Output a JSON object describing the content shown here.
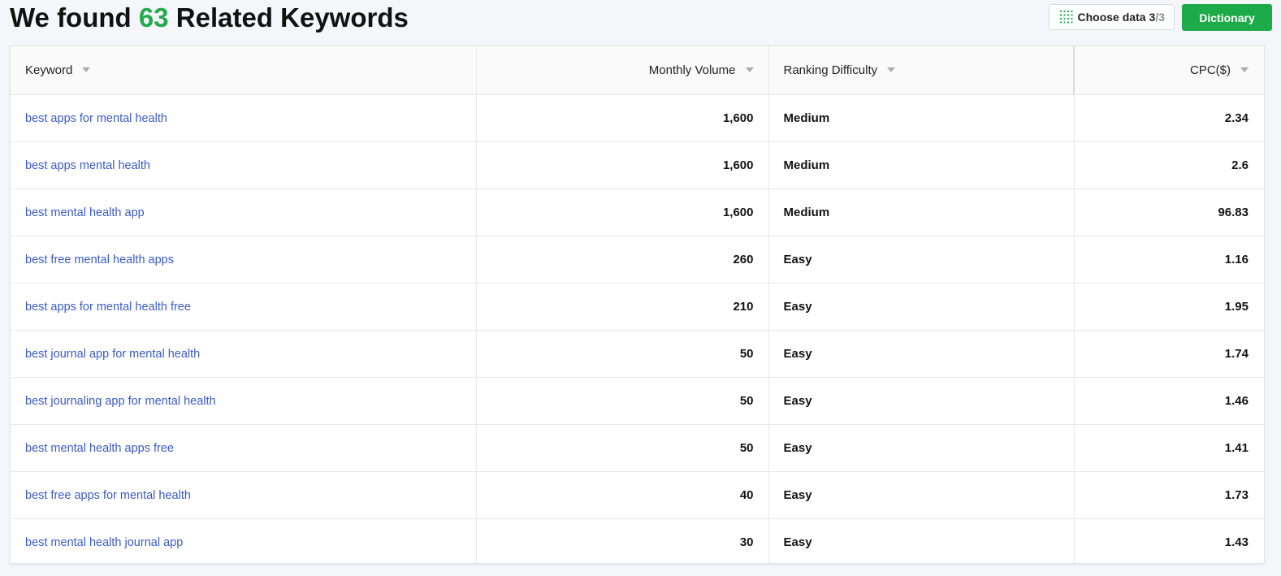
{
  "heading": {
    "prefix": "We found",
    "count": "63",
    "suffix": "Related Keywords"
  },
  "toolbar": {
    "choose_label": "Choose data",
    "choose_selected": "3",
    "choose_separator": "/",
    "choose_total": "3",
    "dictionary_label": "Dictionary"
  },
  "colors": {
    "accent_green": "#1cab48",
    "keyword_link": "#3a5bc7"
  },
  "icons": {
    "choose_data": "grid-icon",
    "sort": "caret-down-icon"
  },
  "table": {
    "headers": {
      "keyword": "Keyword",
      "volume": "Monthly Volume",
      "difficulty": "Ranking Difficulty",
      "cpc": "CPC($)"
    },
    "rows": [
      {
        "keyword": "best apps for mental health",
        "volume": "1,600",
        "difficulty": "Medium",
        "cpc": "2.34"
      },
      {
        "keyword": "best apps mental health",
        "volume": "1,600",
        "difficulty": "Medium",
        "cpc": "2.6"
      },
      {
        "keyword": "best mental health app",
        "volume": "1,600",
        "difficulty": "Medium",
        "cpc": "96.83"
      },
      {
        "keyword": "best free mental health apps",
        "volume": "260",
        "difficulty": "Easy",
        "cpc": "1.16"
      },
      {
        "keyword": "best apps for mental health free",
        "volume": "210",
        "difficulty": "Easy",
        "cpc": "1.95"
      },
      {
        "keyword": "best journal app for mental health",
        "volume": "50",
        "difficulty": "Easy",
        "cpc": "1.74"
      },
      {
        "keyword": "best journaling app for mental health",
        "volume": "50",
        "difficulty": "Easy",
        "cpc": "1.46"
      },
      {
        "keyword": "best mental health apps free",
        "volume": "50",
        "difficulty": "Easy",
        "cpc": "1.41"
      },
      {
        "keyword": "best free apps for mental health",
        "volume": "40",
        "difficulty": "Easy",
        "cpc": "1.73"
      },
      {
        "keyword": "best mental health journal app",
        "volume": "30",
        "difficulty": "Easy",
        "cpc": "1.43"
      }
    ]
  }
}
